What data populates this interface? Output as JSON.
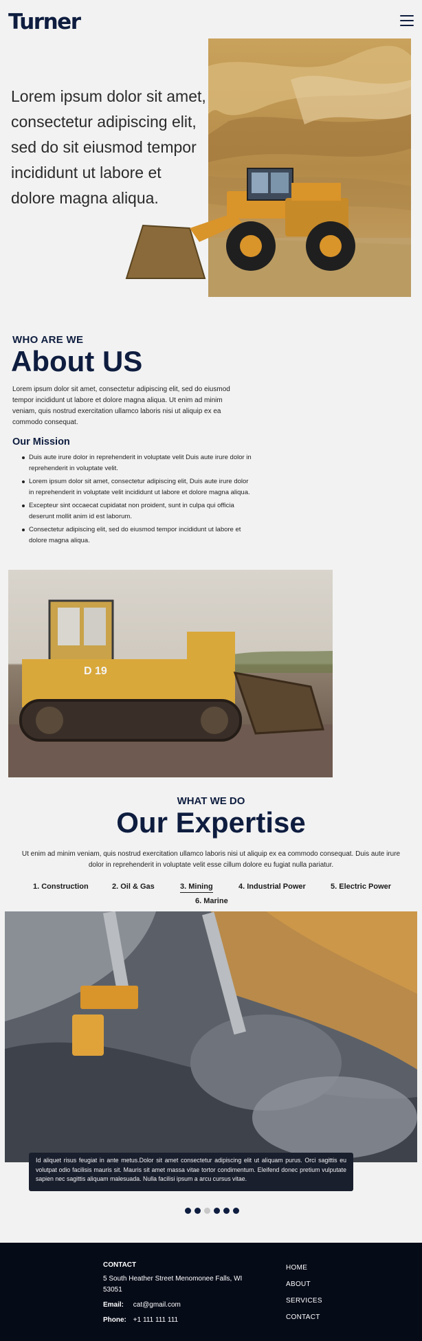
{
  "header": {
    "logo": "Turner",
    "menu_icon": "hamburger-menu-icon"
  },
  "hero": {
    "text": "Lorem ipsum dolor sit amet, consectetur adipiscing elit, sed do sit eiusmod tempor incididunt ut labore et dolore magna aliqua.",
    "image": "wheel-loader-in-quarry"
  },
  "about": {
    "label": "WHO ARE WE",
    "title": "About US",
    "body": "Lorem ipsum dolor sit amet, consectetur adipiscing elit, sed do eiusmod tempor incididunt ut labore et dolore magna aliqua. Ut enim ad minim veniam, quis nostrud exercitation ullamco laboris nisi ut aliquip ex ea commodo consequat.",
    "mission_title": "Our Mission",
    "mission_items": [
      "Duis aute irure dolor in reprehenderit in voluptate velit Duis aute irure dolor in reprehenderit in voluptate velit.",
      "Lorem ipsum dolor sit amet, consectetur adipiscing elit, Duis aute irure dolor in reprehenderit in voluptate velit incididunt ut labore et dolore magna aliqua.",
      "Excepteur sint occaecat cupidatat non proident, sunt in culpa qui officia deserunt mollit anim id est laborum.",
      "Consectetur adipiscing elit, sed do eiusmod tempor incididunt ut labore et dolore magna aliqua."
    ],
    "image": "bulldozer-d19"
  },
  "expertise": {
    "label": "WHAT WE DO",
    "title": "Our Expertise",
    "body": "Ut enim ad minim veniam, quis nostrud exercitation ullamco laboris nisi ut aliquip ex ea commodo consequat. Duis aute irure dolor in reprehenderit in voluptate velit esse cillum dolore eu fugiat nulla pariatur.",
    "tabs": [
      "1. Construction",
      "2. Oil & Gas",
      "3. Mining",
      "4. Industrial Power",
      "5. Electric Power",
      "6. Marine"
    ],
    "active_tab": "3. Mining",
    "image": "aerial-mining-site",
    "caption": "Id aliquet risus feugiat in ante metus.Dolor sit amet consectetur adipiscing elit ut aliquam purus. Orci sagittis eu volutpat odio facilisis mauris sit. Mauris sit amet massa vitae tortor condimentum. Eleifend donec pretium vulputate sapien nec sagittis aliquam malesuada. Nulla facilisi ipsum a arcu cursus vitae.",
    "slide_count": 6,
    "active_slide": 3
  },
  "footer": {
    "contact_heading": "CONTACT",
    "address": "5 South Heather Street Menomonee Falls, WI 53051",
    "email_label": "Email:",
    "email": "cat@gmail.com",
    "phone_label": "Phone:",
    "phone": "+1 111 111 111",
    "nav": [
      "HOME",
      "ABOUT",
      "SERVICES",
      "CONTACT"
    ]
  },
  "colors": {
    "brand_navy": "#0e1d3f",
    "page_bg": "#f2f2f2",
    "footer_bg": "#060b18",
    "caption_bg": "#1a1f2e",
    "inactive_dot": "#c8c8c8"
  }
}
